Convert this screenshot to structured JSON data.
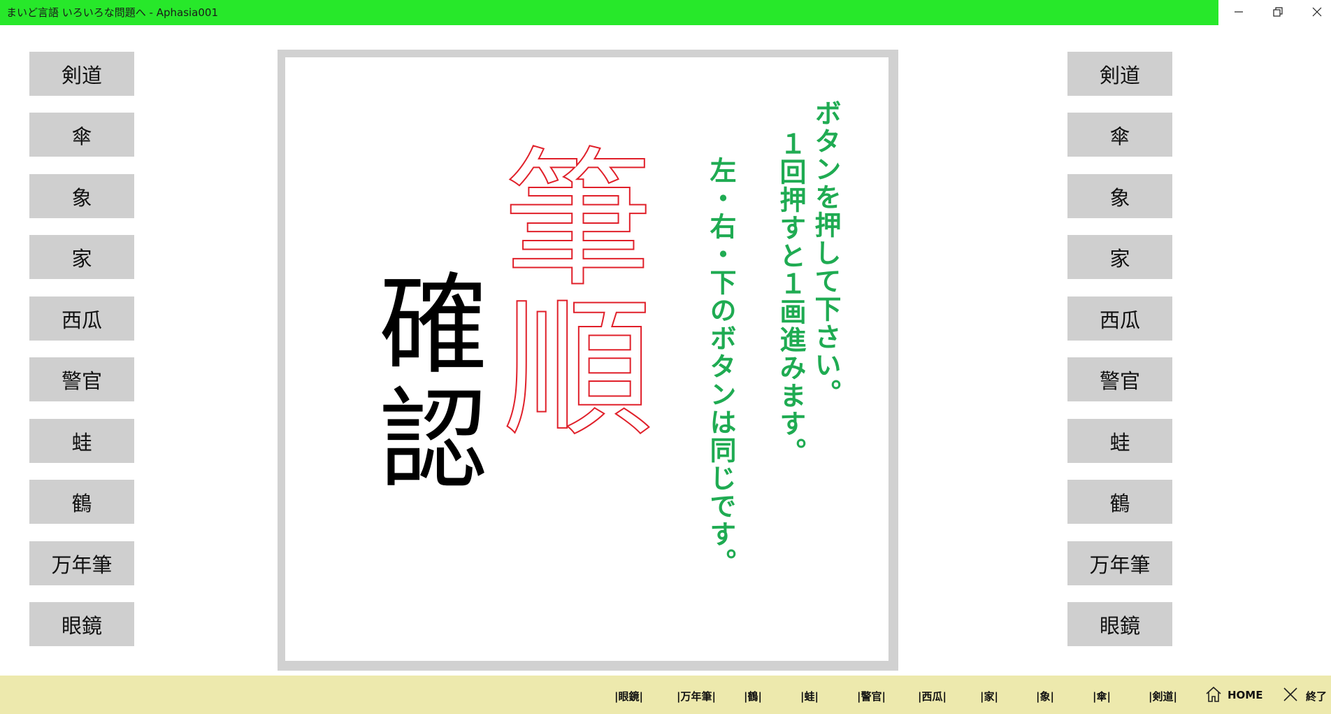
{
  "window": {
    "title": "まいど言語 いろいろな問題へ - Aphasia001",
    "minimize": "—",
    "maximize": "❐",
    "close": "✕"
  },
  "left_buttons": [
    "剣道",
    "傘",
    "象",
    "家",
    "西瓜",
    "警官",
    "蛙",
    "鶴",
    "万年筆",
    "眼鏡"
  ],
  "right_buttons": [
    "剣道",
    "傘",
    "象",
    "家",
    "西瓜",
    "警官",
    "蛙",
    "鶴",
    "万年筆",
    "眼鏡"
  ],
  "board": {
    "kanji_black": "確認",
    "kanji_red": "筆順",
    "instructions": [
      "ボタンを押して下さい。",
      "１回押すと１画進みます。",
      "左・右・下のボタンは同じです。"
    ]
  },
  "bottom_nav": {
    "items": [
      "|眼鏡|",
      "|万年筆|",
      "|鶴|",
      "|蛙|",
      "|警官|",
      "|西瓜|",
      "|家|",
      "|象|",
      "|傘|",
      "|剣道|"
    ],
    "home_label": "HOME",
    "exit_label": "終了"
  },
  "colors": {
    "title_bar": "#27e82a",
    "button_bg": "#cfcfcf",
    "instruction_text": "#1fab52",
    "outline_kanji": "#e0202a",
    "bottom_bar": "#ede9ad"
  }
}
